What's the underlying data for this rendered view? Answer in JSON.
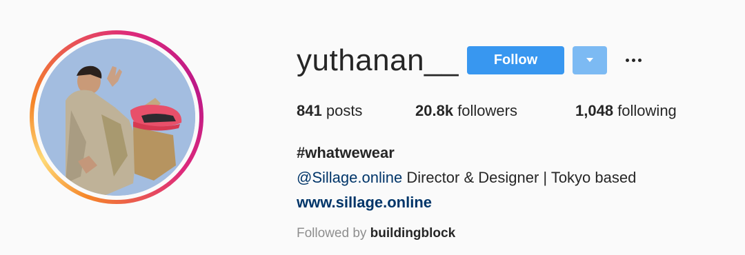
{
  "profile": {
    "username": "yuthanan__",
    "follow_label": "Follow",
    "dropdown_icon": "chevron-down-icon",
    "more_icon": "ellipsis-icon",
    "avatar_icon": "avatar"
  },
  "stats": {
    "posts": {
      "count": "841",
      "label": "posts"
    },
    "followers": {
      "count": "20.8k",
      "label": "followers"
    },
    "following": {
      "count": "1,048",
      "label": "following"
    }
  },
  "bio": {
    "name": "#whatwewear",
    "mention": "@Sillage.online",
    "description": " Director & Designer | Tokyo based",
    "website": "www.sillage.online"
  },
  "followed_by": {
    "prefix": "Followed by ",
    "user": "buildingblock"
  },
  "colors": {
    "follow_button": "#3897f0",
    "dropdown_button": "#7cbaf3",
    "link": "#003569",
    "muted": "#8e8e8e",
    "ring_start": "#f58529",
    "ring_end": "#bc1888"
  }
}
